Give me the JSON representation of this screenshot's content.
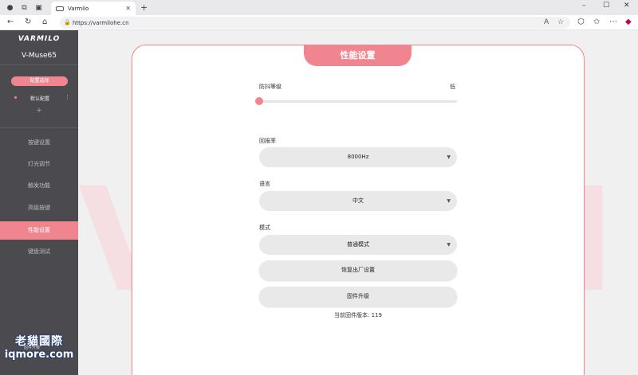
{
  "browser": {
    "tab_title": "Varmilo",
    "url": "https://varmilohe.cn"
  },
  "sidebar": {
    "logo": "VARMILO",
    "model": "V-Muse65",
    "config_select_label": "配置选择",
    "profile_name": "默认配置",
    "add_label": "+",
    "menu": [
      {
        "label": "按键设置",
        "active": false
      },
      {
        "label": "灯光调节",
        "active": false
      },
      {
        "label": "触发功能",
        "active": false
      },
      {
        "label": "高级按键",
        "active": false
      },
      {
        "label": "性能设置",
        "active": true
      },
      {
        "label": "键盘测试",
        "active": false
      }
    ],
    "watermark_line1": "老貓國際",
    "watermark_line2": "iqmore.com",
    "watermark_small": "固件升级"
  },
  "panel": {
    "title": "性能设置",
    "debounce_label": "防抖等级",
    "debounce_value_label": "低",
    "debounce_level": 0,
    "polling_label": "回报率",
    "polling_value": "8000Hz",
    "language_label": "语言",
    "language_value": "中文",
    "mode_label": "模式",
    "mode_value": "普通模式",
    "reset_button": "恢复出厂设置",
    "upgrade_button": "固件升级",
    "firmware_version": "当前固件版本: 119"
  },
  "colors": {
    "accent": "#f08590",
    "sidebar_bg": "#4b4b4f"
  }
}
